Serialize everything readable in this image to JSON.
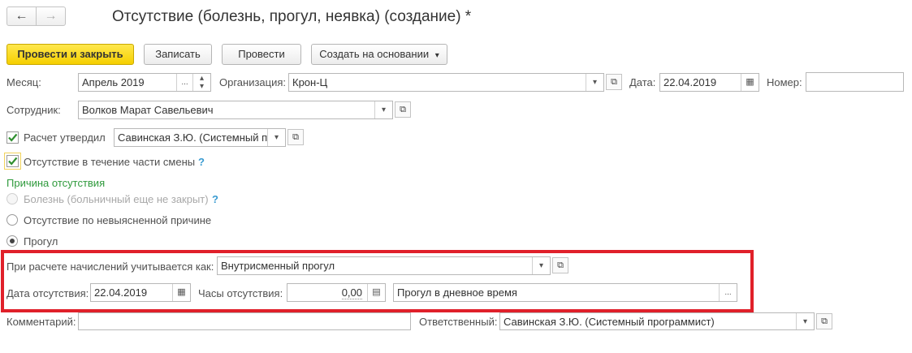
{
  "window": {
    "title": "Отсутствие (болезнь, прогул, неявка) (создание) *"
  },
  "toolbar": {
    "post_close": "Провести и закрыть",
    "save": "Записать",
    "post": "Провести",
    "create_based": "Создать на основании"
  },
  "form": {
    "month_label": "Месяц:",
    "month_value": "Апрель 2019",
    "org_label": "Организация:",
    "org_value": "Крон-Ц",
    "date_label": "Дата:",
    "date_value": "22.04.2019",
    "number_label": "Номер:",
    "number_value": "",
    "employee_label": "Сотрудник:",
    "employee_value": "Волков Марат Савельевич",
    "approved_label": "Расчет утвердил",
    "approved_value": "Савинская З.Ю. (Системный п",
    "partial_shift_label": "Отсутствие в течение части смены",
    "help_mark": "?",
    "reason_section": "Причина отсутствия",
    "reason_sick": "Болезнь (больничный еще не закрыт)",
    "reason_unknown": "Отсутствие по невыясненной причине",
    "reason_absent": "Прогул",
    "accrual_label": "При расчете начислений учитывается как:",
    "accrual_value": "Внутрисменный прогул",
    "absence_date_label": "Дата отсутствия:",
    "absence_date_value": "22.04.2019",
    "hours_label": "Часы отсутствия:",
    "hours_value": "0,00",
    "time_kind_value": "Прогул в дневное время",
    "comment_label": "Комментарий:",
    "comment_value": "",
    "responsible_label": "Ответственный:",
    "responsible_value": "Савинская З.Ю. (Системный программист)"
  },
  "icons": {
    "back": "←",
    "forward": "→",
    "ellipsis": "...",
    "dropdown": "▾",
    "spin_up": "▴",
    "spin_down": "▾"
  },
  "colors": {
    "primary_button": "#f5cf00",
    "highlight_frame": "#e0202a",
    "section_title": "#2f9a3c",
    "help": "#3a9bd1"
  }
}
